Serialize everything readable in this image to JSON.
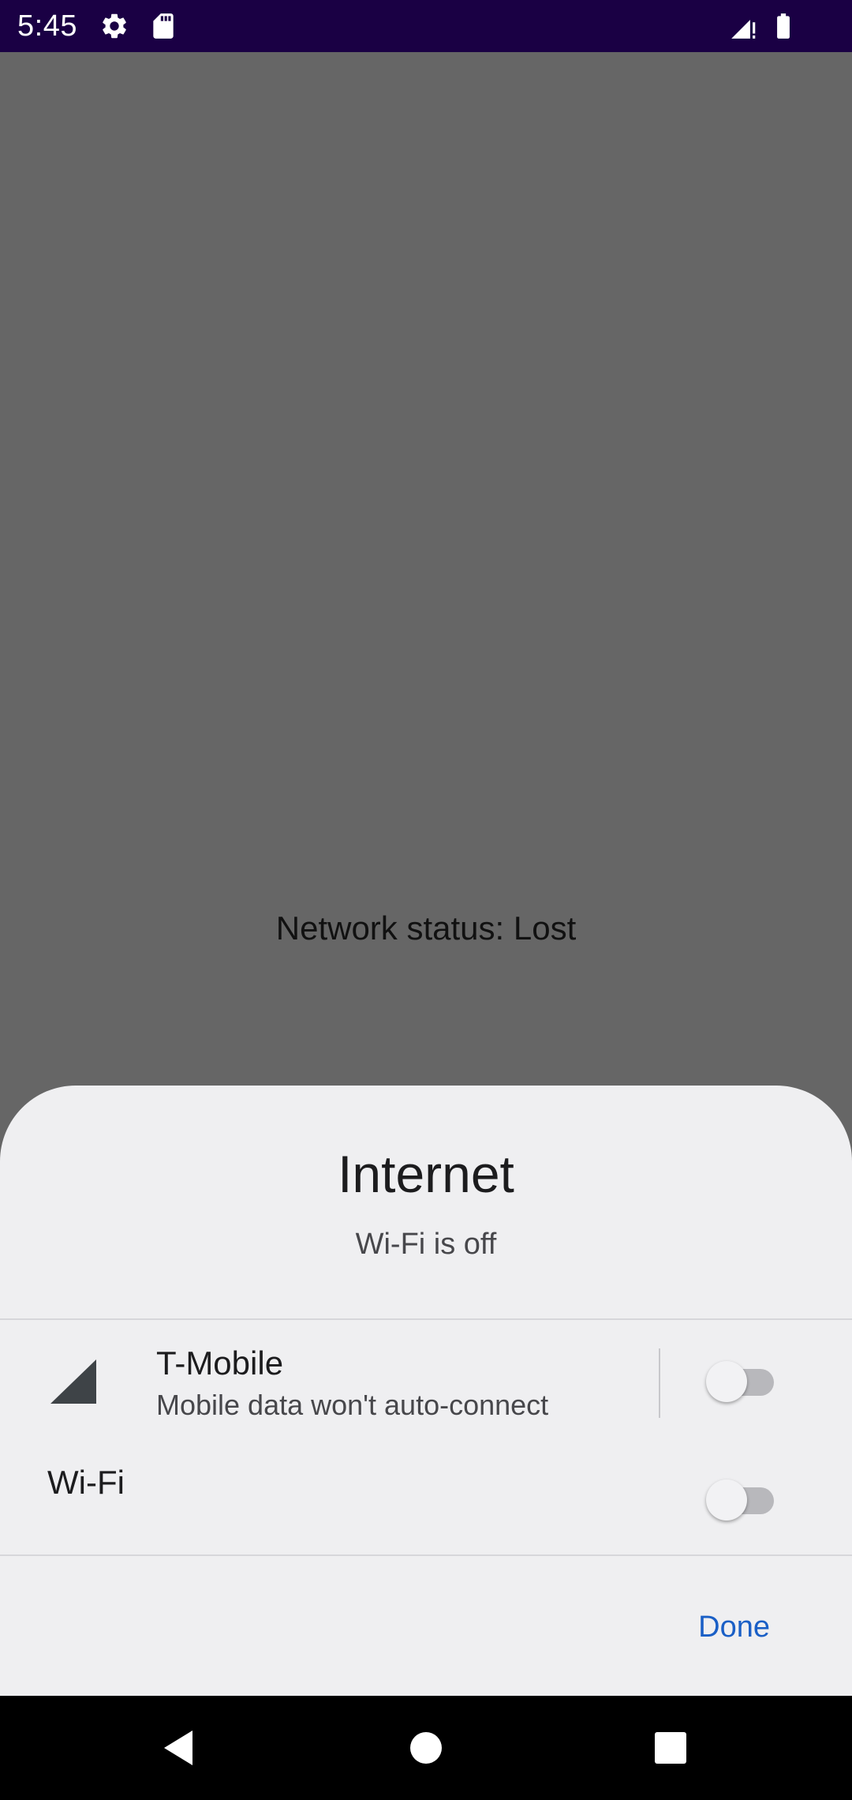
{
  "status_bar": {
    "time": "5:45",
    "icons": [
      "settings-gear-icon",
      "sd-card-icon",
      "signal-no-data-icon",
      "battery-icon"
    ]
  },
  "app": {
    "network_status": "Network status: Lost"
  },
  "internet_panel": {
    "title": "Internet",
    "subtitle": "Wi-Fi is off",
    "mobile": {
      "carrier": "T-Mobile",
      "status": "Mobile data won't auto-connect",
      "enabled": false,
      "icon": "cell-signal-icon"
    },
    "wifi": {
      "label": "Wi-Fi",
      "enabled": false
    },
    "done_label": "Done"
  },
  "nav_bar": {
    "buttons": [
      "back-icon",
      "home-icon",
      "recents-icon"
    ]
  },
  "colors": {
    "status_bar": "#1a0044",
    "scrim": "#666666",
    "sheet": "#efeff1",
    "accent": "#1a5fc6"
  }
}
